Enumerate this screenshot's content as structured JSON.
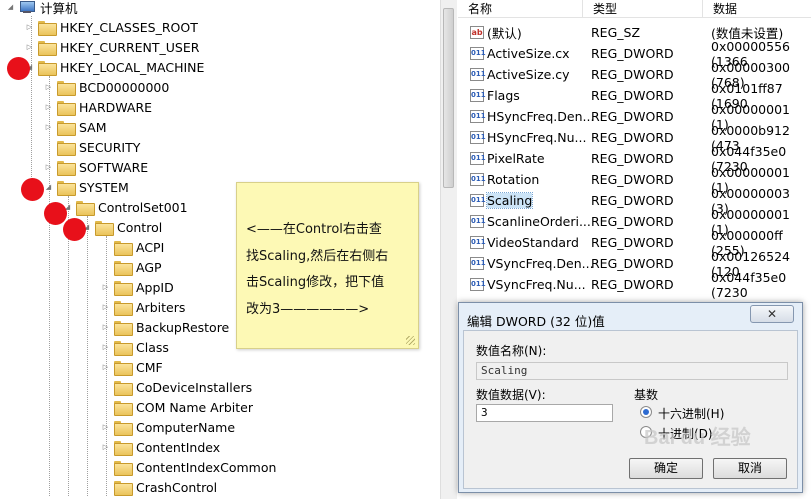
{
  "tree": {
    "root": "计算机",
    "hives": [
      "HKEY_CLASSES_ROOT",
      "HKEY_CURRENT_USER",
      "HKEY_LOCAL_MACHINE"
    ],
    "hklm_children": [
      "BCD00000000",
      "HARDWARE",
      "SAM",
      "SECURITY",
      "SOFTWARE",
      "SYSTEM"
    ],
    "system_child": "ControlSet001",
    "controlset_child": "Control",
    "control_children": [
      "ACPI",
      "AGP",
      "AppID",
      "Arbiters",
      "BackupRestore",
      "Class",
      "CMF",
      "CoDeviceInstallers",
      "COM Name Arbiter",
      "ComputerName",
      "ContentIndex",
      "ContentIndexCommon",
      "CrashControl"
    ]
  },
  "values_pane": {
    "headers": {
      "name": "名称",
      "type": "类型",
      "data": "数据"
    },
    "rows": [
      {
        "icon": "ab",
        "name": "(默认)",
        "type": "REG_SZ",
        "data": "(数值未设置)"
      },
      {
        "icon": "bin",
        "name": "ActiveSize.cx",
        "type": "REG_DWORD",
        "data": "0x00000556 (1366"
      },
      {
        "icon": "bin",
        "name": "ActiveSize.cy",
        "type": "REG_DWORD",
        "data": "0x00000300 (768)"
      },
      {
        "icon": "bin",
        "name": "Flags",
        "type": "REG_DWORD",
        "data": "0x0101ff87 (1690"
      },
      {
        "icon": "bin",
        "name": "HSyncFreq.Den...",
        "type": "REG_DWORD",
        "data": "0x00000001 (1)"
      },
      {
        "icon": "bin",
        "name": "HSyncFreq.Nu...",
        "type": "REG_DWORD",
        "data": "0x0000b912 (473"
      },
      {
        "icon": "bin",
        "name": "PixelRate",
        "type": "REG_DWORD",
        "data": "0x044f35e0 (7230"
      },
      {
        "icon": "bin",
        "name": "Rotation",
        "type": "REG_DWORD",
        "data": "0x00000001 (1)"
      },
      {
        "icon": "bin",
        "name": "Scaling",
        "type": "REG_DWORD",
        "data": "0x00000003 (3)"
      },
      {
        "icon": "bin",
        "name": "ScanlineOrderi...",
        "type": "REG_DWORD",
        "data": "0x00000001 (1)"
      },
      {
        "icon": "bin",
        "name": "VideoStandard",
        "type": "REG_DWORD",
        "data": "0x000000ff (255)"
      },
      {
        "icon": "bin",
        "name": "VSyncFreq.Den...",
        "type": "REG_DWORD",
        "data": "0x00126524 (120"
      },
      {
        "icon": "bin",
        "name": "VSyncFreq.Nu...",
        "type": "REG_DWORD",
        "data": "0x044f35e0 (7230"
      }
    ]
  },
  "note": {
    "line1": "<——在Control右击查",
    "line2": "找Scaling,然后在右侧右",
    "line3": "击Scaling修改，把下值",
    "line4": "改为3——————>"
  },
  "dialog": {
    "title": "编辑 DWORD (32 位)值",
    "close": "✕",
    "name_label": "数值名称(N):",
    "name_value": "Scaling",
    "data_label": "数值数据(V):",
    "data_value": "3",
    "base_label": "基数",
    "hex_label": "十六进制(H)",
    "dec_label": "十进制(D)",
    "ok": "确定",
    "cancel": "取消",
    "watermark": "Bai du 经验"
  },
  "colors": {
    "annotation_dot": "#e8101a",
    "note_bg": "#fdf9b5",
    "selection": "#cce4f7"
  }
}
